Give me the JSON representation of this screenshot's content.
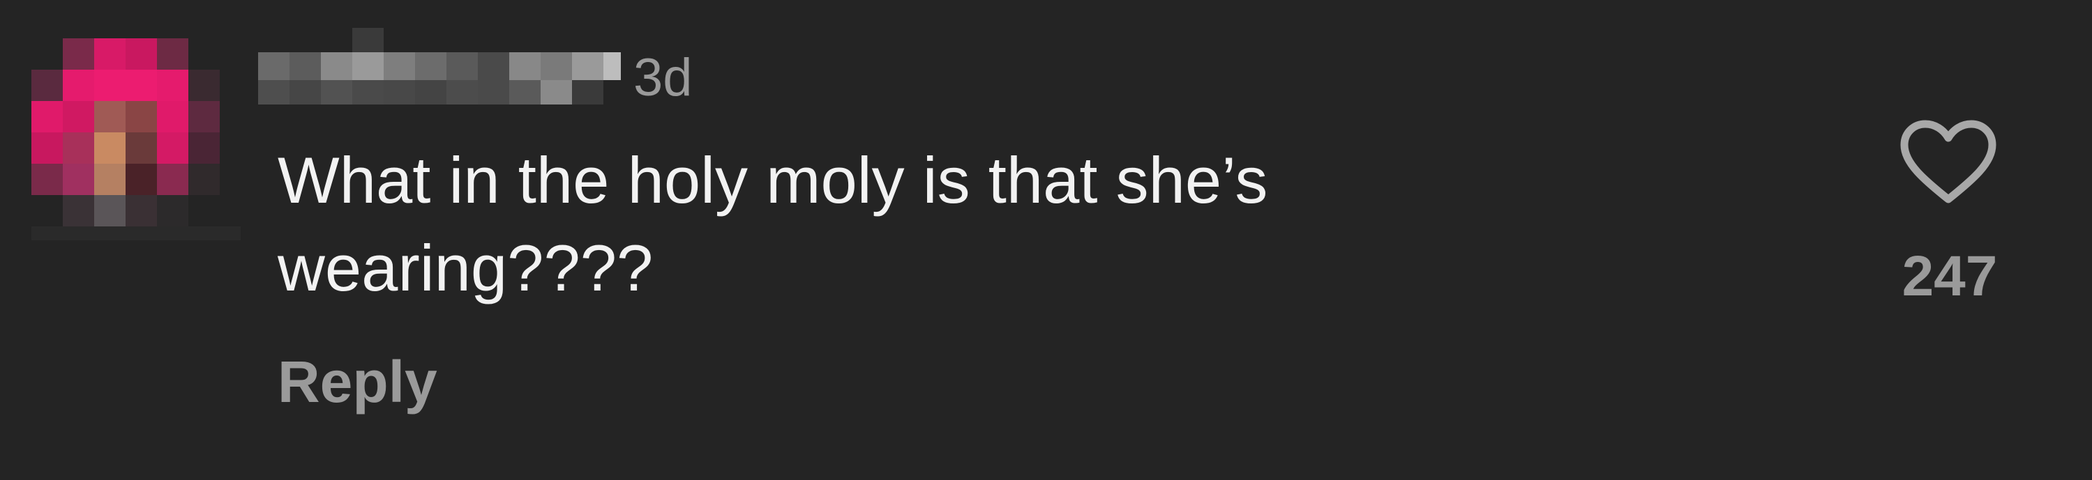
{
  "comment": {
    "timestamp": "3d",
    "text": "What in the holy moly is that she’s\nwearing????",
    "reply_label": "Reply",
    "like_count": "247",
    "like_icon": "heart-icon",
    "avatar_pixelated": true,
    "username_pixelated": true
  },
  "colors": {
    "background": "#242424",
    "text_primary": "#f2f2f2",
    "text_secondary": "#9a9a9a",
    "avatar_accent": "#e8196b"
  }
}
